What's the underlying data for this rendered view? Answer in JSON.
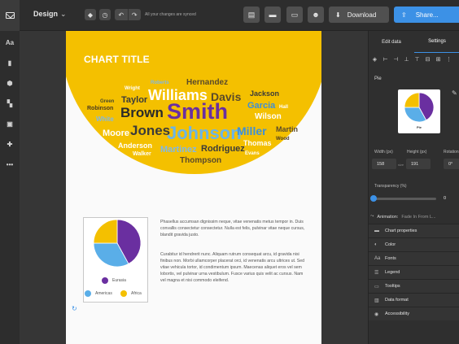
{
  "topbar": {
    "logo_icon": "envelope-icon",
    "project_name": "Design",
    "sync_status": "All your changes are synced",
    "download_label": "Download",
    "share_label": "Share..."
  },
  "chart": {
    "title": "CHART TITLE",
    "words": [
      {
        "text": "Hernandez",
        "color": "#5a4a2a"
      },
      {
        "text": "Roberts",
        "color": "#7fb8e8"
      },
      {
        "text": "Wright",
        "color": "#ffffff"
      },
      {
        "text": "Williams",
        "color": "#ffffff"
      },
      {
        "text": "Davis",
        "color": "#5a4a2a"
      },
      {
        "text": "Jackson",
        "color": "#3a3a3a"
      },
      {
        "text": "Green",
        "color": "#4a4a2a"
      },
      {
        "text": "Taylor",
        "color": "#3a3a3a"
      },
      {
        "text": "Garcia",
        "color": "#3d8fd8"
      },
      {
        "text": "Hall",
        "color": "#ffffff"
      },
      {
        "text": "Robinson",
        "color": "#4a3a20"
      },
      {
        "text": "Brown",
        "color": "#2a2a2a"
      },
      {
        "text": "Smith",
        "color": "#6a2fa0"
      },
      {
        "text": "Wilson",
        "color": "#ffffff"
      },
      {
        "text": "White",
        "color": "#7fb8e8"
      },
      {
        "text": "Moore",
        "color": "#ffffff"
      },
      {
        "text": "Jones",
        "color": "#3a3a3a"
      },
      {
        "text": "Johnson",
        "color": "#6ab4e8"
      },
      {
        "text": "Miller",
        "color": "#3d8fd8"
      },
      {
        "text": "Martin",
        "color": "#5a4a2a"
      },
      {
        "text": "Wood",
        "color": "#4a3a20"
      },
      {
        "text": "Anderson",
        "color": "#ffffff"
      },
      {
        "text": "Thomas",
        "color": "#ffffff"
      },
      {
        "text": "Walker",
        "color": "#ffffff"
      },
      {
        "text": "Martinez",
        "color": "#7fb8e8"
      },
      {
        "text": "Rodriguez",
        "color": "#3a3a3a"
      },
      {
        "text": "Evans",
        "color": "#ffffff"
      },
      {
        "text": "Thompson",
        "color": "#5a4a2a"
      }
    ]
  },
  "chart_data": {
    "type": "pie",
    "categories": [
      "Eurasia",
      "Americas",
      "Africa"
    ],
    "values": [
      42,
      33,
      25
    ],
    "colors": [
      "#6a2fa0",
      "#5aaee8",
      "#f4c000"
    ],
    "legend_position": "bottom"
  },
  "body_text": {
    "paragraph1": "Phasellus accumsan dignissim neque, vitae venenatis metus tempor in. Duis convallis consectetur consectetur. Nulla est felis, pulvinar vitae neque cursus, blandit gravida justo.",
    "paragraph2": "Curabitur id hendrerit nunc. Aliquam rutrum consequat arcu, id gravida nisi finibus non. Morbi ullamcorper placerat orci, id venenatis arcu ultrices ut. Sed vitae vehicula tortor, id condimentum ipsum. Maecenas aliquet eros vel sem lobortis, vel pulvinar urna vestibulum. Fusce varius quis velit ac cursus. Nam vel magna et nisi commodo eleifend."
  },
  "panel": {
    "tabs": [
      "Edit data",
      "Settings"
    ],
    "chart_type": "Pie",
    "thumb_label": "Pie",
    "width_label": "Width (px)",
    "width_value": "158",
    "height_label": "Height (px)",
    "height_value": "191",
    "rotation_label": "Rotation",
    "rotation_value": "0°",
    "lock_label": "size",
    "transparency_label": "Transparency (%)",
    "transparency_value": "0",
    "animation_label": "Animation:",
    "animation_value": "Fade In From L...",
    "sections": [
      "Chart properties",
      "Color",
      "Fonts",
      "Legend",
      "Tooltips",
      "Data format",
      "Accessibility"
    ]
  }
}
